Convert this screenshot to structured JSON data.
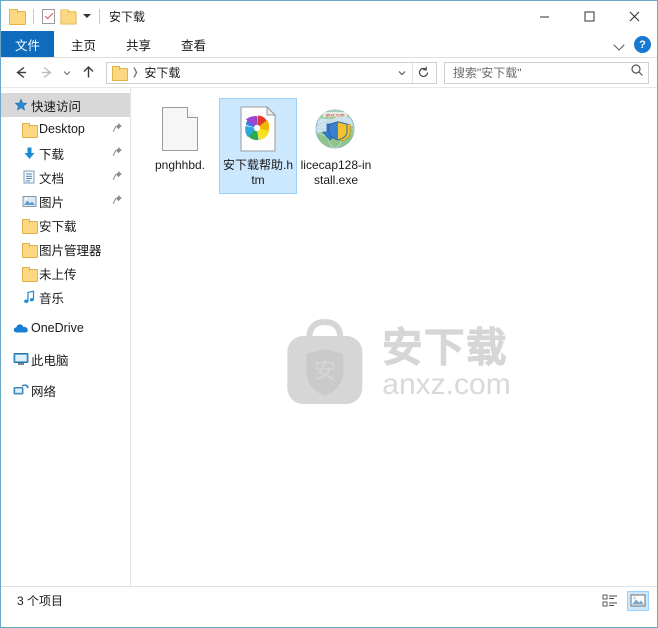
{
  "window": {
    "title": "安下载",
    "quick_access_toolbar": [
      {
        "name": "folder-icon",
        "label": "文件夹"
      },
      {
        "name": "properties-icon",
        "label": "属性"
      },
      {
        "name": "new-folder-icon",
        "label": "新建文件夹"
      },
      {
        "name": "customize-dropdown",
        "label": "自定义快速访问工具栏"
      }
    ],
    "controls": {
      "minimize": "最小化",
      "maximize": "最大化",
      "close": "关闭"
    }
  },
  "ribbon": {
    "tabs": [
      {
        "label": "文件",
        "active": true
      },
      {
        "label": "主页",
        "active": false
      },
      {
        "label": "共享",
        "active": false
      },
      {
        "label": "查看",
        "active": false
      }
    ],
    "collapse_label": "展开功能区",
    "help_label": "?"
  },
  "navigation": {
    "back": "后退",
    "forward": "前进",
    "recent": "最近浏览的位置",
    "up": "向上",
    "breadcrumb": [
      "安下载"
    ],
    "dropdown": "上一个位置",
    "refresh": "刷新"
  },
  "search": {
    "placeholder": "搜索\"安下载\"",
    "icon": "search-icon"
  },
  "sidebar": {
    "items": [
      {
        "label": "快速访问",
        "icon": "star-icon",
        "selected": true,
        "pinned": false,
        "indent": 0
      },
      {
        "label": "Desktop",
        "icon": "folder-icon",
        "selected": false,
        "pinned": true,
        "indent": 1
      },
      {
        "label": "下载",
        "icon": "download-icon",
        "selected": false,
        "pinned": true,
        "indent": 1
      },
      {
        "label": "文档",
        "icon": "documents-icon",
        "selected": false,
        "pinned": true,
        "indent": 1
      },
      {
        "label": "图片",
        "icon": "pictures-icon",
        "selected": false,
        "pinned": true,
        "indent": 1
      },
      {
        "label": "安下载",
        "icon": "folder-icon",
        "selected": false,
        "pinned": false,
        "indent": 1
      },
      {
        "label": "图片管理器",
        "icon": "folder-icon",
        "selected": false,
        "pinned": false,
        "indent": 1
      },
      {
        "label": "未上传",
        "icon": "folder-icon",
        "selected": false,
        "pinned": false,
        "indent": 1
      },
      {
        "label": "音乐",
        "icon": "music-icon",
        "selected": false,
        "pinned": false,
        "indent": 1
      }
    ],
    "roots": [
      {
        "label": "OneDrive",
        "icon": "cloud-icon"
      },
      {
        "label": "此电脑",
        "icon": "computer-icon"
      },
      {
        "label": "网络",
        "icon": "network-icon"
      }
    ]
  },
  "files": [
    {
      "label": "pnghhbd.",
      "icon": "blank-document-icon",
      "selected": false
    },
    {
      "label": "安下载帮助.htm",
      "icon": "html-chrome-icon",
      "selected": true
    },
    {
      "label": "licecap128-install.exe",
      "icon": "installer-exe-icon",
      "selected": false
    }
  ],
  "watermark": {
    "logo": "anxz-bag-logo",
    "logo_char": "安",
    "cn_text": "安下载",
    "en_text": "anxz.com"
  },
  "statusbar": {
    "count": "3 个项目",
    "views": [
      {
        "name": "details-view-button",
        "label": "详细信息",
        "active": false
      },
      {
        "name": "large-icons-view-button",
        "label": "大图标",
        "active": true
      }
    ]
  },
  "colors": {
    "accent": "#0f6cbd",
    "selection_fill": "#cce8ff",
    "selection_border": "#99d1ff",
    "folder_yellow": "#fcd980",
    "window_border": "#6fa8c7",
    "watermark_gray": "#d6d6d6"
  }
}
